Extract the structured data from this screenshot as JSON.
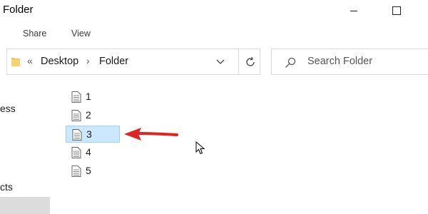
{
  "window": {
    "title": "Folder"
  },
  "ribbon": {
    "tabs": [
      {
        "label": "Share"
      },
      {
        "label": "View"
      }
    ]
  },
  "address_bar": {
    "overflow_glyph": "«",
    "separator_glyph": "›",
    "breadcrumbs": [
      {
        "label": "Desktop"
      },
      {
        "label": "Folder"
      }
    ]
  },
  "search": {
    "placeholder": "Search Folder"
  },
  "navigation_pane": {
    "items": [
      {
        "label": "ess"
      },
      {
        "label": "cts"
      }
    ]
  },
  "files": [
    {
      "name": "1",
      "selected": false
    },
    {
      "name": "2",
      "selected": false
    },
    {
      "name": "3",
      "selected": true
    },
    {
      "name": "4",
      "selected": false
    },
    {
      "name": "5",
      "selected": false
    }
  ],
  "icons": {
    "folder": "folder-icon",
    "document": "document-icon",
    "dropdown": "chevron-down-icon",
    "refresh": "refresh-icon",
    "search": "search-icon",
    "minimize": "minimize-icon",
    "maximize": "maximize-icon",
    "annotation": "red-arrow-icon",
    "cursor": "mouse-cursor-icon"
  },
  "colors": {
    "selection_fill": "#cce8ff",
    "selection_border": "#99d1ff",
    "annotation_arrow": "#e02424",
    "folder_icon": "#f0c050"
  }
}
